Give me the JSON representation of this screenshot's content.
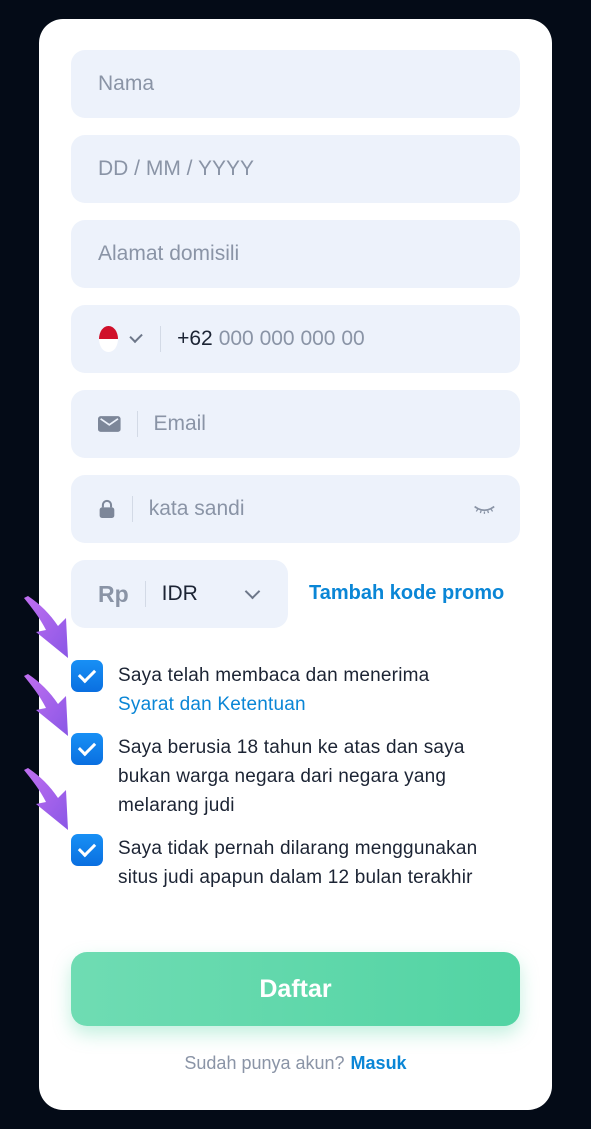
{
  "form": {
    "name_placeholder": "Nama",
    "dob_placeholder": "DD / MM / YYYY",
    "address_placeholder": "Alamat domisili",
    "phone": {
      "prefix": "+62",
      "placeholder": "000 000 000 00",
      "country_flag": "indonesia-flag-icon"
    },
    "email_placeholder": "Email",
    "password_placeholder": "kata sandi",
    "currency": {
      "symbol": "Rp",
      "code": "IDR"
    },
    "promo_label": "Tambah kode promo"
  },
  "checkboxes": [
    {
      "text": "Saya telah membaca dan menerima",
      "link": "Syarat dan Ketentuan",
      "checked": true
    },
    {
      "text": "Saya berusia 18 tahun ke atas dan saya bukan warga negara dari negara yang melarang judi",
      "checked": true
    },
    {
      "text": "Saya tidak pernah dilarang menggunakan situs judi apapun dalam 12 bulan terakhir",
      "checked": true
    }
  ],
  "submit_label": "Daftar",
  "footer": {
    "question": "Sudah punya akun?",
    "login_label": "Masuk"
  },
  "colors": {
    "accent": "#0a86d6",
    "checkbox": "#1890f5",
    "submit": "#5ed6a8",
    "field_bg": "#edf2fb",
    "page_bg": "#040b17",
    "arrow": "#b36be8"
  }
}
